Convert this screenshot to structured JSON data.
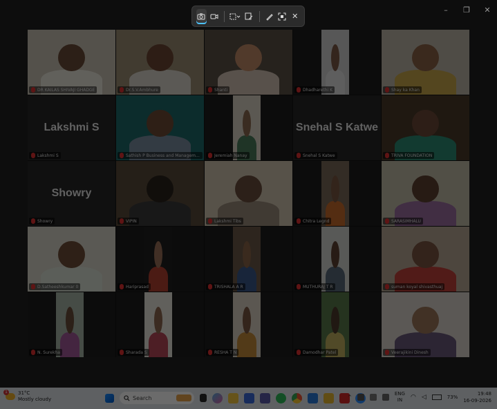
{
  "snip_toolbar": {
    "close_glyph": "✕"
  },
  "window_controls": {
    "minimize": "–",
    "maximize": "❐",
    "close": "✕"
  },
  "participants": [
    {
      "name": "DR KAILAS SHIVAJI GHADGE",
      "display": "DR KAILAS SHIVAJI GHADGE",
      "mode": "video",
      "bg": "#c9c2b2",
      "skin": "#6a4a38",
      "shirt": "#e8e4da"
    },
    {
      "name": "Dr.S.V.Ambhure",
      "display": "Dr.S.V.Ambhure",
      "mode": "video",
      "bg": "#9c8c74",
      "skin": "#6b4632",
      "shirt": "#d9d4ca",
      "active": true
    },
    {
      "name": "Shanti",
      "display": "Shanti",
      "mode": "video",
      "bg": "#5b5147",
      "skin": "#c08a66",
      "shirt": "#d2c2b2"
    },
    {
      "name": "Dhadharethi K",
      "display": "Dhadharethi K",
      "mode": "video",
      "bg": "#cfcfcf",
      "skin": "#7d5a45",
      "shirt": "#e1e1e1",
      "narrow": true
    },
    {
      "name": "Shay ka Khan",
      "display": "Shay ka Khan",
      "mode": "video",
      "bg": "#bcb5a8",
      "skin": "#8b6346",
      "shirt": "#c9a64a"
    },
    {
      "name": "Lakshmi S",
      "display": "Lakshmi S",
      "mode": "text"
    },
    {
      "name": "Sathish P Business and Management BGSF",
      "display": "Sathish P Business and Management BGSF",
      "mode": "video",
      "bg": "#1e6a6a",
      "skin": "#6e4a36",
      "shirt": "#7b8ea0"
    },
    {
      "name": "Jeremiah Nanay",
      "display": "Jeremiah Nanay",
      "mode": "video",
      "bg": "#d8d2c4",
      "skin": "#8b6a50",
      "shirt": "#4b7c5c",
      "narrow": true
    },
    {
      "name": "Snehal S Katwe",
      "display": "Snehal S Katwe",
      "mode": "text"
    },
    {
      "name": "TRIVA FOUNDATION",
      "display": "TRIVA FOUNDATION",
      "mode": "video",
      "bg": "#4a3a2a",
      "skin": "#6b4838",
      "shirt": "#2d8a73"
    },
    {
      "name": "Showry",
      "display": "Showry",
      "mode": "text"
    },
    {
      "name": "VIPIN",
      "display": "VIPIN",
      "mode": "video",
      "bg": "#5a4a3a",
      "skin": "#2a221c",
      "shirt": "#3a3a3a"
    },
    {
      "name": "Lakshmi Tibs",
      "display": "Lakshmi Tibs",
      "mode": "video",
      "bg": "#cfc4ae",
      "skin": "#6a4e3c",
      "shirt": "#9a8a7a"
    },
    {
      "name": "Chitra Leg",
      "display": "Chitra Legnd",
      "mode": "video",
      "bg": "#7a6a5a",
      "skin": "#7a5640",
      "shirt": "#c96b2c",
      "narrow": true
    },
    {
      "name": "SARASIMHALU",
      "display": "SARASIMHALU",
      "mode": "video",
      "bg": "#c2bca8",
      "skin": "#5e4030",
      "shirt": "#9b6fa0"
    },
    {
      "name": "D.Satheeshkumar",
      "display": "D.Satheeshkumar 0",
      "mode": "video",
      "bg": "#d6d4c8",
      "skin": "#6e4e38",
      "shirt": "#d8e0d4"
    },
    {
      "name": "Hariprasad",
      "display": "Hariprasad",
      "mode": "video",
      "bg": "#1f1f1f",
      "skin": "#9c7058",
      "shirt": "#b44030",
      "narrow": true
    },
    {
      "name": "TRISHALA A",
      "display": "TRISHALA A R",
      "mode": "video",
      "bg": "#6d5a48",
      "skin": "#8a6448",
      "shirt": "#3a5a8a",
      "narrow": true
    },
    {
      "name": "MUTHURAJ T R",
      "display": "MUTHURAJ T R",
      "mode": "video",
      "bg": "#d2d4d0",
      "skin": "#5e4232",
      "shirt": "#5a6a7a",
      "narrow": true
    },
    {
      "name": "Suman Koyal",
      "display": "suman koyal shivasthuaj",
      "mode": "video",
      "bg": "#b8a894",
      "skin": "#7a5440",
      "shirt": "#c0403a"
    },
    {
      "name": "N. Surekha",
      "display": "N. Surekha",
      "mode": "video",
      "bg": "#a8b6a6",
      "skin": "#6a4e3a",
      "shirt": "#a35a9a",
      "narrow": true
    },
    {
      "name": "Sharada S",
      "display": "Sharada S",
      "mode": "video",
      "bg": "#e8e4dc",
      "skin": "#8e6850",
      "shirt": "#b8485a",
      "narrow": true
    },
    {
      "name": "RESHA T N",
      "display": "RESHA T N",
      "mode": "video",
      "bg": "#d8cfc0",
      "skin": "#7a5640",
      "shirt": "#c48a3a",
      "narrow": true
    },
    {
      "name": "Damodhar Patel",
      "display": "Damodhar Patel",
      "mode": "video",
      "bg": "#5a7a4a",
      "skin": "#4e3a2c",
      "shirt": "#c0b060",
      "narrow": true
    },
    {
      "name": "Veerajikini Dinesh",
      "display": "Veerajikini Dinesh",
      "mode": "video",
      "bg": "#d8d2ca",
      "skin": "#9c7658",
      "shirt": "#6a5a7a"
    }
  ],
  "taskbar": {
    "weather_temp": "31°C",
    "weather_desc": "Mostly cloudy",
    "weather_badge": "1",
    "search_placeholder": "Search",
    "lang_top": "ENG",
    "lang_bottom": "IN",
    "battery": "73%",
    "time": "19:48",
    "date": "16-09-2026"
  },
  "colors": {
    "accent": "#4cc2ff",
    "mic_muted": "#e03030",
    "active_speaker": "#2f8f4e"
  }
}
